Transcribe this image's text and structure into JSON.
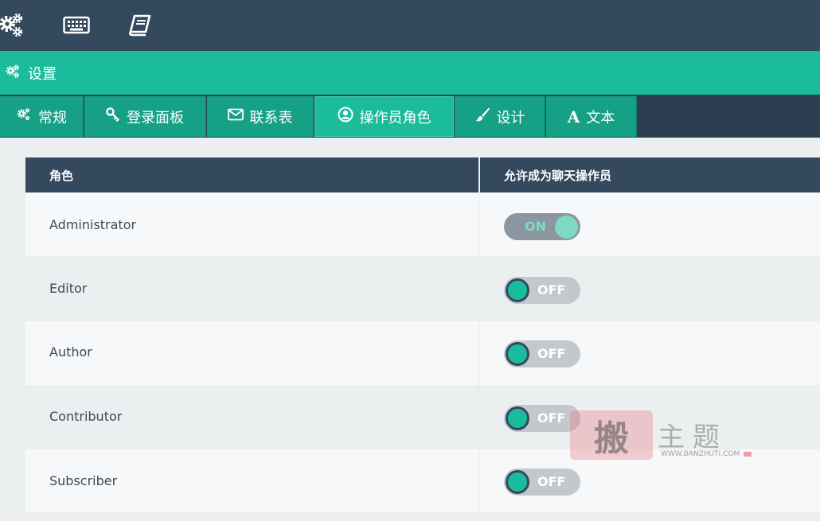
{
  "topbar": {
    "icons": [
      "gears-icon",
      "keyboard-icon",
      "book-icon"
    ]
  },
  "header": {
    "title": "设置",
    "icon": "gears-icon"
  },
  "tabs": [
    {
      "label": "常规",
      "icon": "gears-icon",
      "active": false
    },
    {
      "label": "登录面板",
      "icon": "key-icon",
      "active": false
    },
    {
      "label": "联系表",
      "icon": "envelope-icon",
      "active": false
    },
    {
      "label": "操作员角色",
      "icon": "user-circle-icon",
      "active": true
    },
    {
      "label": "设计",
      "icon": "brush-icon",
      "active": false
    },
    {
      "label": "文本",
      "icon": "font-icon",
      "active": false
    }
  ],
  "table": {
    "headers": [
      "角色",
      "允许成为聊天操作员"
    ],
    "rows": [
      {
        "role": "Administrator",
        "toggle": "ON",
        "enabled": true
      },
      {
        "role": "Editor",
        "toggle": "OFF",
        "enabled": false
      },
      {
        "role": "Author",
        "toggle": "OFF",
        "enabled": false
      },
      {
        "role": "Contributor",
        "toggle": "OFF",
        "enabled": false
      },
      {
        "role": "Subscriber",
        "toggle": "OFF",
        "enabled": false
      }
    ]
  },
  "watermark": {
    "seal": "搬",
    "chars": "主题",
    "url": "WWW.BANZHUTI.COM"
  },
  "colors": {
    "header": "#34495e",
    "accent": "#1abc9c",
    "tab": "#16a085",
    "toggle_track": "#c3c8cc"
  }
}
